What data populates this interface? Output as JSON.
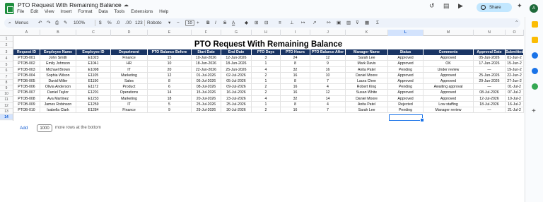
{
  "app": {
    "title": "PTO Request With Remaining Balance",
    "menu": [
      "File",
      "Edit",
      "View",
      "Insert",
      "Format",
      "Data",
      "Tools",
      "Extensions",
      "Help"
    ],
    "share_label": "Share",
    "avatar_initial": "A"
  },
  "toolbar": {
    "menus_label": "Menus",
    "zoom": "100%",
    "currency": "$",
    "percent": "%",
    "decrease_decimal": ".0",
    "increase_decimal": ".00",
    "number_format": "123",
    "font": "Roboto",
    "font_size": "10",
    "bold": "B",
    "italic": "I",
    "strikethrough": "S",
    "text_color": "A"
  },
  "columns": [
    "A",
    "B",
    "C",
    "D",
    "E",
    "F",
    "G",
    "H",
    "I",
    "J",
    "K",
    "L",
    "M",
    "N",
    "O"
  ],
  "selected_column": "L",
  "rows": [
    "1",
    "2",
    "3",
    "4",
    "5",
    "6",
    "7",
    "8",
    "9",
    "10",
    "11",
    "12",
    "13",
    "14"
  ],
  "selected_row": "14",
  "sheet": {
    "title": "PTO Request With Remaining Balance",
    "headers": [
      "Request ID",
      "Employee Name",
      "Employee ID",
      "Department",
      "PTO Balance Before",
      "Start Date",
      "End Date",
      "PTO Days",
      "PTO Hours",
      "PTO Balance After",
      "Manager Name",
      "Status",
      "Comments",
      "Approval Date",
      "Submitted"
    ],
    "data": [
      [
        "PTOB-001",
        "John Smith",
        "E1023",
        "Finance",
        "15",
        "10-Jun-2026",
        "12-Jun-2026",
        "3",
        "24",
        "12",
        "Sarah Lee",
        "Approved",
        "Approved",
        "05-Jun-2026",
        "01-Jun-2"
      ],
      [
        "PTOB-002",
        "Emily Johnson",
        "E1041",
        "HR",
        "10",
        "18-Jun-2026",
        "18-Jun-2026",
        "1",
        "8",
        "9",
        "Mark Davis",
        "Approved",
        "OK",
        "17-Jun-2026",
        "15-Jun-2"
      ],
      [
        "PTOB-003",
        "Michael Brown",
        "E1098",
        "IT",
        "20",
        "22-Jun-2026",
        "25-Jun-2026",
        "4",
        "32",
        "16",
        "Anita Patel",
        "Pending",
        "Under review",
        "—",
        "19-Jun-2"
      ],
      [
        "PTOB-004",
        "Sophia Wilson",
        "E1105",
        "Marketing",
        "12",
        "01-Jul-2026",
        "02-Jul-2026",
        "2",
        "16",
        "10",
        "Daniel Moore",
        "Approved",
        "Approved",
        "25-Jun-2026",
        "22-Jun-2"
      ],
      [
        "PTOB-005",
        "David Miller",
        "E1150",
        "Sales",
        "8",
        "05-Jul-2026",
        "05-Jul-2026",
        "1",
        "8",
        "7",
        "Laura Chen",
        "Approved",
        "Approved",
        "29-Jun-2026",
        "27-Jun-2"
      ],
      [
        "PTOB-006",
        "Olivia Anderson",
        "E1172",
        "Product",
        "6",
        "08-Jul-2026",
        "09-Jul-2026",
        "2",
        "16",
        "4",
        "Robert King",
        "Pending",
        "Awaiting approval",
        "—",
        "01-Jul-2"
      ],
      [
        "PTOB-007",
        "Daniel Taylor",
        "E1201",
        "Operations",
        "14",
        "15-Jul-2026",
        "16-Jul-2026",
        "2",
        "16",
        "12",
        "Susan White",
        "Approved",
        "Approved",
        "08-Jul-2026",
        "07-Jul-2"
      ],
      [
        "PTOB-008",
        "Ava Martinez",
        "E1233",
        "Marketing",
        "18",
        "20-Jul-2026",
        "23-Jul-2026",
        "4",
        "32",
        "14",
        "Daniel Moore",
        "Approved",
        "Approved",
        "12-Jul-2026",
        "10-Jul-2"
      ],
      [
        "PTOB-009",
        "James Robinson",
        "E1259",
        "IT",
        "5",
        "25-Jul-2026",
        "25-Jul-2026",
        "1",
        "8",
        "4",
        "Anita Patel",
        "Rejected",
        "Low staffing",
        "18-Jul-2026",
        "16-Jul-2"
      ],
      [
        "PTOB-010",
        "Isabella Clark",
        "E1284",
        "Finance",
        "9",
        "29-Jul-2026",
        "30-Jul-2026",
        "2",
        "16",
        "7",
        "Sarah Lee",
        "Pending",
        "Manager review",
        "—",
        "21-Jul-2"
      ]
    ]
  },
  "footer": {
    "add_label": "Add",
    "rows_value": "1000",
    "rows_text": "more rows at the bottom"
  }
}
